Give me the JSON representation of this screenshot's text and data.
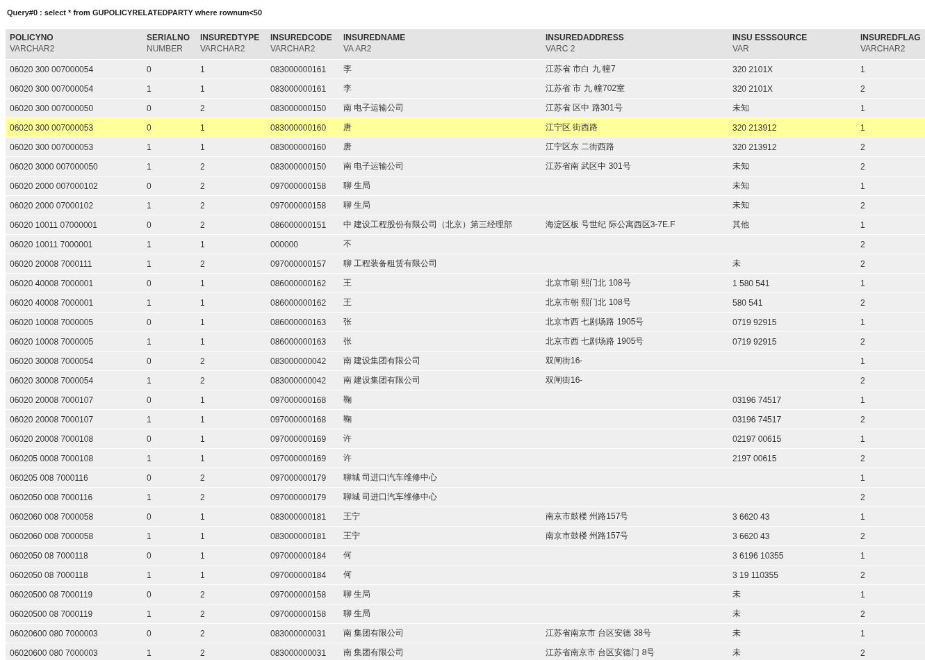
{
  "query": "Query#0 : select * from GUPOLICYRELATEDPARTY where rownum<50",
  "table": {
    "columns": [
      {
        "name": "POLICYNO",
        "type": "VARCHAR2"
      },
      {
        "name": "SERIALNO",
        "type": "NUMBER"
      },
      {
        "name": "INSUREDTYPE",
        "type": "VARCHAR2"
      },
      {
        "name": "INSUREDCODE",
        "type": "VARCHAR2"
      },
      {
        "name": "INSUREDNAME",
        "type": "VA AR2"
      },
      {
        "name": "INSUREDADDRESS",
        "type": "VARC 2"
      },
      {
        "name": "INSU ESSSOURCE",
        "type": "VAR"
      },
      {
        "name": "INSUREDFLAG",
        "type": "VARCHAR2"
      }
    ],
    "rows": [
      {
        "selected": false,
        "cells": [
          "06020 300 007000054",
          "0",
          "1",
          "083000000161",
          "李",
          "江苏省 市白 九 幢7",
          "320 2101X",
          "1"
        ]
      },
      {
        "selected": false,
        "cells": [
          "06020 300 007000054",
          "1",
          "1",
          "083000000161",
          "李",
          "江苏省 市 九 幢702室",
          "320 2101X",
          "2"
        ]
      },
      {
        "selected": false,
        "cells": [
          "06020 300 007000050",
          "0",
          "2",
          "083000000150",
          "南 电子运输公司",
          "江苏省 区中 路301号",
          "未知",
          "1"
        ]
      },
      {
        "selected": true,
        "cells": [
          "06020 300 007000053",
          "0",
          "1",
          "083000000160",
          "唐",
          "江宁区 街西路",
          "320 213912",
          "1"
        ]
      },
      {
        "selected": false,
        "cells": [
          "06020 300 007000053",
          "1",
          "1",
          "083000000160",
          "唐",
          "江宁区东 二街西路",
          "320 213912",
          "2"
        ]
      },
      {
        "selected": false,
        "cells": [
          "06020 3000 007000050",
          "1",
          "2",
          "083000000150",
          "南 电子运输公司",
          "江苏省南 武区中 301号",
          "未知",
          "2"
        ]
      },
      {
        "selected": false,
        "cells": [
          "06020 2000 007000102",
          "0",
          "2",
          "097000000158",
          "聊 生局",
          "",
          "未知",
          "1"
        ]
      },
      {
        "selected": false,
        "cells": [
          "06020 2000 07000102",
          "1",
          "2",
          "097000000158",
          "聊 生局",
          "",
          "未知",
          "2"
        ]
      },
      {
        "selected": false,
        "cells": [
          "06020 10011 07000001",
          "0",
          "2",
          "086000000151",
          "中 建设工程股份有限公司（北京）第三经理部",
          "海淀区板 号世纪 际公寓西区3-7E.F",
          "其他",
          "1"
        ]
      },
      {
        "selected": false,
        "cells": [
          "06020 10011 7000001",
          "1",
          "1",
          "000000",
          "不",
          "",
          "",
          "2"
        ]
      },
      {
        "selected": false,
        "cells": [
          "06020 20008 7000111",
          "1",
          "2",
          "097000000157",
          "聊 工程装备租赁有限公司",
          "",
          "未",
          "2"
        ]
      },
      {
        "selected": false,
        "cells": [
          "06020 40008 7000001",
          "0",
          "1",
          "086000000162",
          "王",
          "北京市朝 熙门北 108号",
          "1 580 541",
          "1"
        ]
      },
      {
        "selected": false,
        "cells": [
          "06020 40008 7000001",
          "1",
          "1",
          "086000000162",
          "王",
          "北京市朝 熙门北 108号",
          "580 541",
          "2"
        ]
      },
      {
        "selected": false,
        "cells": [
          "06020 10008 7000005",
          "0",
          "1",
          "086000000163",
          "张",
          "北京市西 七剧场路 1905号",
          "0719 92915",
          "1"
        ]
      },
      {
        "selected": false,
        "cells": [
          "06020 10008 7000005",
          "1",
          "1",
          "086000000163",
          "张",
          "北京市西 七剧场路 1905号",
          "0719 92915",
          "2"
        ]
      },
      {
        "selected": false,
        "cells": [
          "06020 30008 7000054",
          "0",
          "2",
          "083000000042",
          "南 建设集团有限公司",
          "双闸街16-",
          "",
          "1"
        ]
      },
      {
        "selected": false,
        "cells": [
          "06020 30008 7000054",
          "1",
          "2",
          "083000000042",
          "南 建设集团有限公司",
          "双闸街16-",
          "",
          "2"
        ]
      },
      {
        "selected": false,
        "cells": [
          "06020 20008 7000107",
          "0",
          "1",
          "097000000168",
          "鞠",
          "",
          "03196 74517",
          "1"
        ]
      },
      {
        "selected": false,
        "cells": [
          "06020 20008 7000107",
          "1",
          "1",
          "097000000168",
          "鞠",
          "",
          "03196 74517",
          "2"
        ]
      },
      {
        "selected": false,
        "cells": [
          "06020 20008 7000108",
          "0",
          "1",
          "097000000169",
          "许",
          "",
          "02197 00615",
          "1"
        ]
      },
      {
        "selected": false,
        "cells": [
          "060205 0008 7000108",
          "1",
          "1",
          "097000000169",
          "许",
          "",
          "2197 00615",
          "2"
        ]
      },
      {
        "selected": false,
        "cells": [
          "060205 008 7000116",
          "0",
          "2",
          "097000000179",
          "聊城 司进口汽车维修中心",
          "",
          "",
          "1"
        ]
      },
      {
        "selected": false,
        "cells": [
          "0602050 008 7000116",
          "1",
          "2",
          "097000000179",
          "聊城 司进口汽车维修中心",
          "",
          "",
          "2"
        ]
      },
      {
        "selected": false,
        "cells": [
          "0602060 008 7000058",
          "0",
          "1",
          "083000000181",
          "王宁",
          "南京市鼓楼 州路157号",
          "3 6620 43",
          "1"
        ]
      },
      {
        "selected": false,
        "cells": [
          "0602060 008 7000058",
          "1",
          "1",
          "083000000181",
          "王宁",
          "南京市鼓楼 州路157号",
          "3 6620 43",
          "2"
        ]
      },
      {
        "selected": false,
        "cells": [
          "0602050 08 7000118",
          "0",
          "1",
          "097000000184",
          "何",
          "",
          "3 6196 10355",
          "1"
        ]
      },
      {
        "selected": false,
        "cells": [
          "0602050 08 7000118",
          "1",
          "1",
          "097000000184",
          "何",
          "",
          "3 19 110355",
          "2"
        ]
      },
      {
        "selected": false,
        "cells": [
          "06020500 08 7000119",
          "0",
          "2",
          "097000000158",
          "聊 生局",
          "",
          "未",
          "1"
        ]
      },
      {
        "selected": false,
        "cells": [
          "06020500 08 7000119",
          "1",
          "2",
          "097000000158",
          "聊 生局",
          "",
          "未",
          "2"
        ]
      },
      {
        "selected": false,
        "cells": [
          "06020600 080 7000003",
          "0",
          "2",
          "083000000031",
          "南 集团有限公司",
          "江苏省南京市 台区安德 38号",
          "未",
          "1"
        ]
      },
      {
        "selected": false,
        "cells": [
          "06020600 080 7000003",
          "1",
          "2",
          "083000000031",
          "南 集团有限公司",
          "江苏省南京市 台区安德门 8号",
          "未",
          "2"
        ]
      }
    ]
  }
}
